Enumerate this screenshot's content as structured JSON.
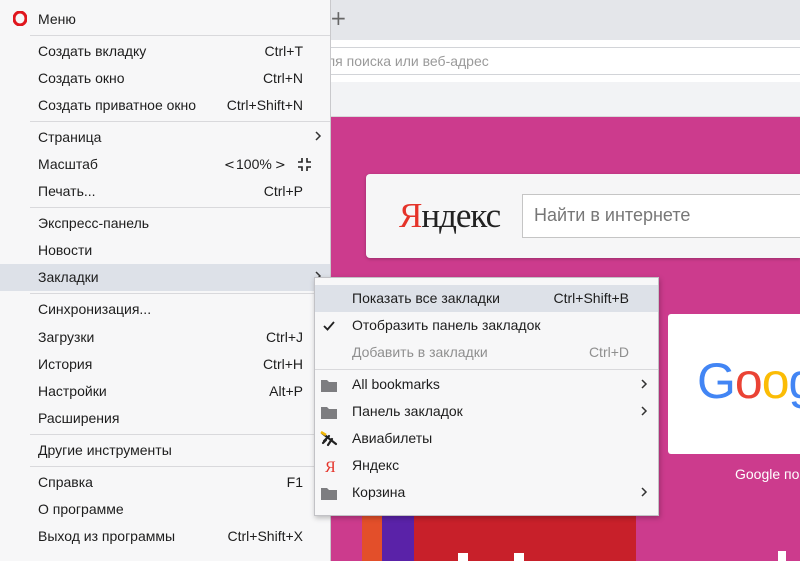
{
  "browser": {
    "newtab_glyph": "+",
    "address_placeholder": "Введите запрос для поиска или веб-адрес",
    "address_visible": "ля поиска или веб-адрес"
  },
  "speeddial": {
    "yandex_logo_first": "Я",
    "yandex_logo_rest": "ндекс",
    "yandex_search_placeholder": "Найти в интернете",
    "google_logo": [
      "G",
      "o",
      "o",
      "g"
    ],
    "google_caption": "Google по"
  },
  "menu": {
    "title": "Меню",
    "items": [
      {
        "label": "Создать вкладку",
        "shortcut": "Ctrl+T"
      },
      {
        "label": "Создать окно",
        "shortcut": "Ctrl+N"
      },
      {
        "label": "Создать приватное окно",
        "shortcut": "Ctrl+Shift+N"
      },
      {
        "label": "Страница",
        "shortcut": ""
      },
      {
        "label": "Масштаб",
        "shortcut": ""
      },
      {
        "label": "Печать...",
        "shortcut": "Ctrl+P"
      },
      {
        "label": "Экспресс-панель",
        "shortcut": ""
      },
      {
        "label": "Новости",
        "shortcut": ""
      },
      {
        "label": "Закладки",
        "shortcut": ""
      },
      {
        "label": "Синхронизация...",
        "shortcut": ""
      },
      {
        "label": "Загрузки",
        "shortcut": "Ctrl+J"
      },
      {
        "label": "История",
        "shortcut": "Ctrl+H"
      },
      {
        "label": "Настройки",
        "shortcut": "Alt+P"
      },
      {
        "label": "Расширения",
        "shortcut": ""
      },
      {
        "label": "Другие инструменты",
        "shortcut": ""
      },
      {
        "label": "Справка",
        "shortcut": "F1"
      },
      {
        "label": "О программе",
        "shortcut": ""
      },
      {
        "label": "Выход из программы",
        "shortcut": "Ctrl+Shift+X"
      }
    ],
    "zoom": {
      "value": "100%",
      "dec_glyph": "<",
      "inc_glyph": ">"
    }
  },
  "bookmarks_submenu": {
    "items": [
      {
        "label": "Показать все закладки",
        "shortcut": "Ctrl+Shift+B",
        "icon": "none"
      },
      {
        "label": "Отобразить панель закладок",
        "shortcut": "",
        "icon": "checkmark-icon"
      },
      {
        "label": "Добавить в закладки",
        "shortcut": "Ctrl+D",
        "icon": "none"
      },
      {
        "label": "All bookmarks",
        "shortcut": "",
        "icon": "folder-icon"
      },
      {
        "label": "Панель закладок",
        "shortcut": "",
        "icon": "folder-icon"
      },
      {
        "label": "Авиабилеты",
        "shortcut": "",
        "icon": "airplane-icon"
      },
      {
        "label": "Яндекс",
        "shortcut": "",
        "icon": "yandex-icon"
      },
      {
        "label": "Корзина",
        "shortcut": "",
        "icon": "folder-icon"
      }
    ]
  },
  "colors": {
    "opera_red": "#e0161d",
    "yandex_red": "#e5332a",
    "speeddial_bg": "#cc3b8d",
    "highlight": "#dde1e8"
  }
}
